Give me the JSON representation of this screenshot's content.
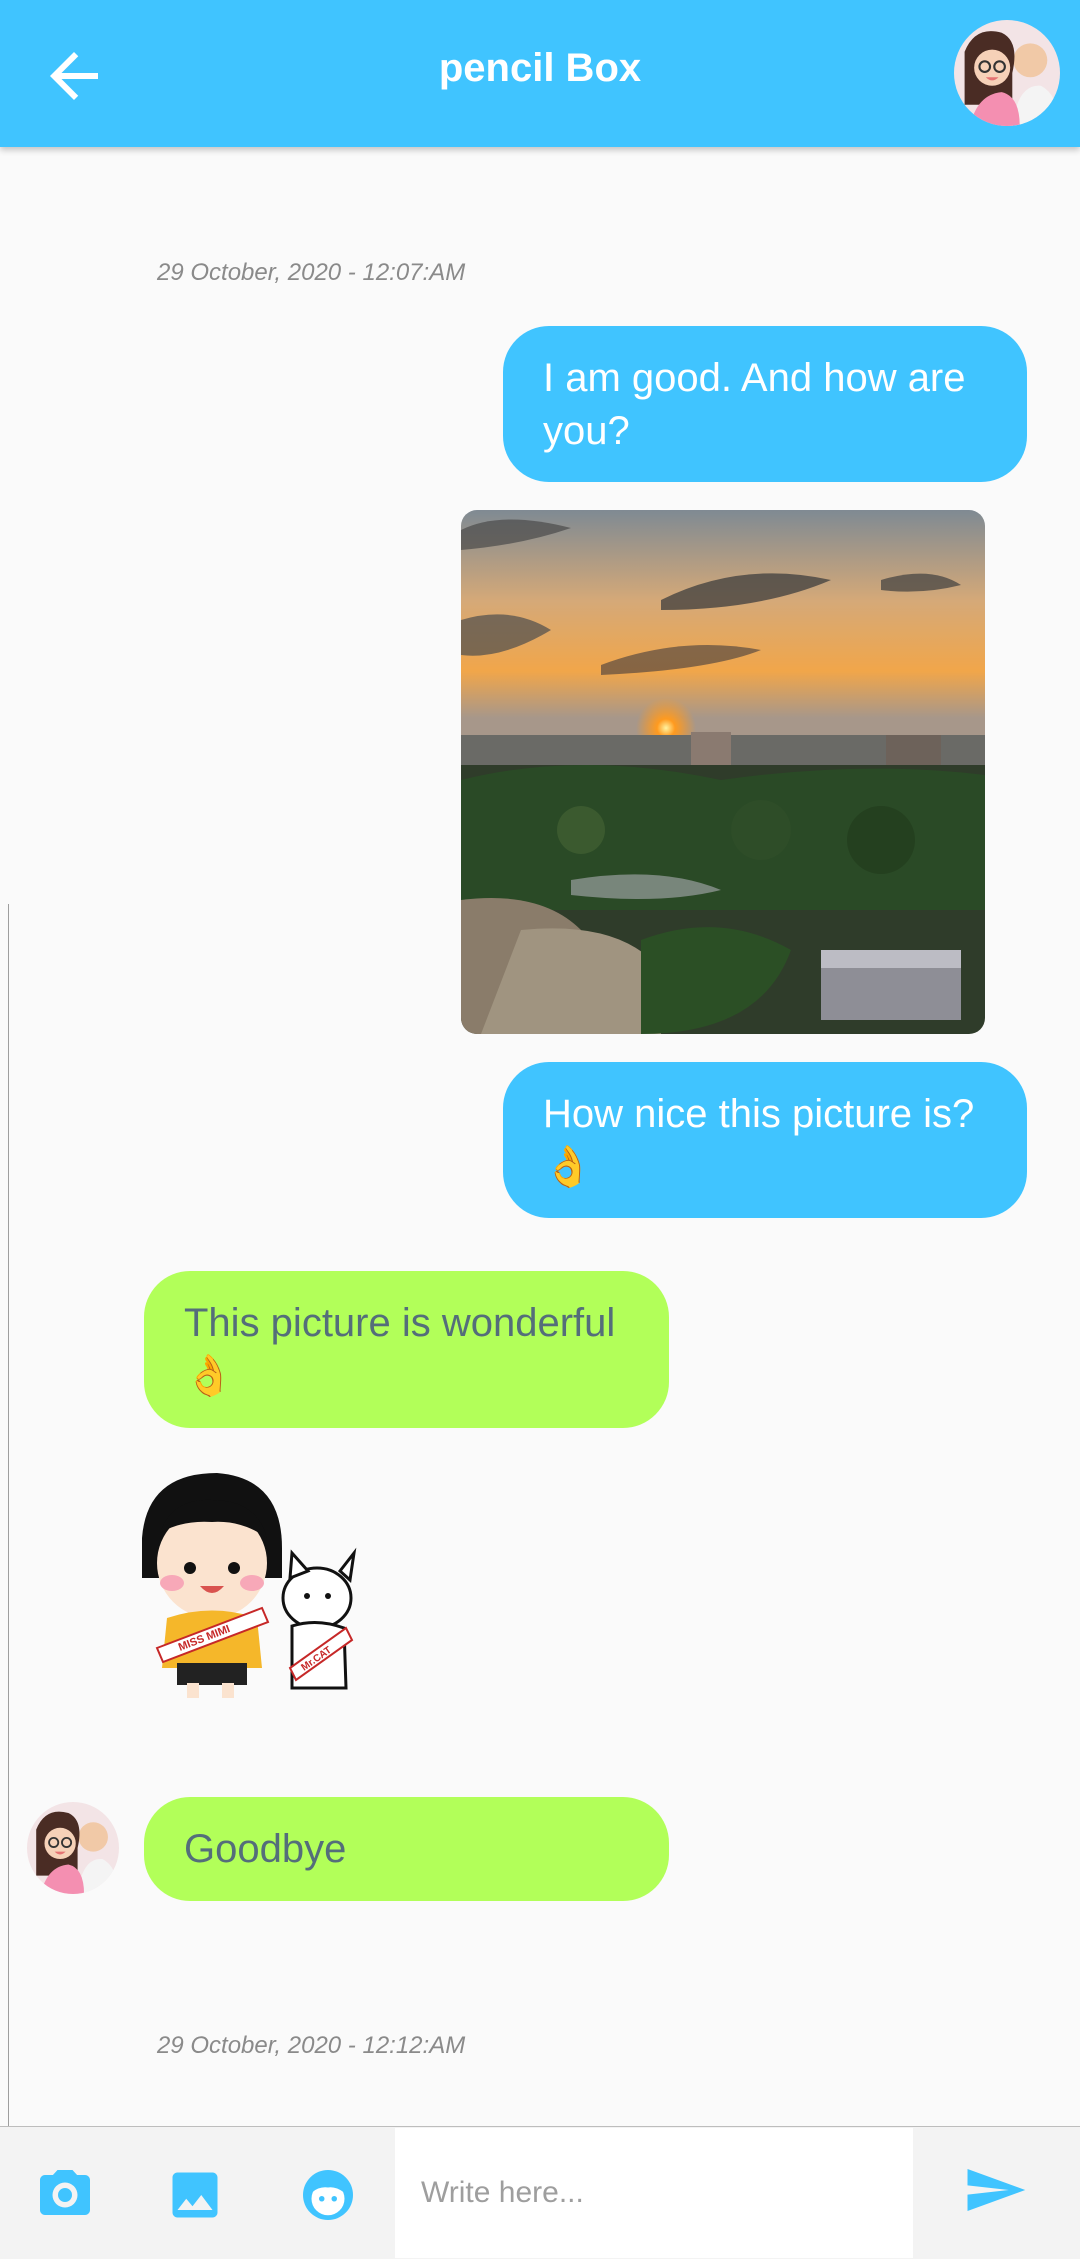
{
  "header": {
    "title": "pencil Box",
    "back_icon": "arrow-back-icon",
    "avatar": "couple-avatar"
  },
  "messages": [
    {
      "type": "timestamp",
      "text": "29 October, 2020 - 12:07:AM"
    },
    {
      "type": "text",
      "direction": "sent",
      "text": "I am good. And how are you?"
    },
    {
      "type": "image",
      "direction": "sent",
      "description_icon": "sunset-photo"
    },
    {
      "type": "text",
      "direction": "sent",
      "text": "How nice this picture is?",
      "emoji": "👌"
    },
    {
      "type": "text",
      "direction": "received",
      "text": "This picture is wonderful",
      "emoji": "👌"
    },
    {
      "type": "sticker",
      "direction": "received",
      "label_1": "MISS MIMI",
      "label_2": "Mr.CAT"
    },
    {
      "type": "text",
      "direction": "received",
      "text": "Goodbye",
      "avatar": "couple-avatar"
    },
    {
      "type": "timestamp",
      "text": "29 October, 2020 - 12:12:AM"
    }
  ],
  "composer": {
    "placeholder": "Write here...",
    "value": "",
    "icons": [
      "camera-icon",
      "gallery-icon",
      "sticker-icon",
      "send-icon"
    ]
  },
  "colors": {
    "primary": "#40c4ff",
    "received_bubble": "#b2ff59",
    "received_text": "#546e7a",
    "timestamp": "#8a8a8a"
  }
}
